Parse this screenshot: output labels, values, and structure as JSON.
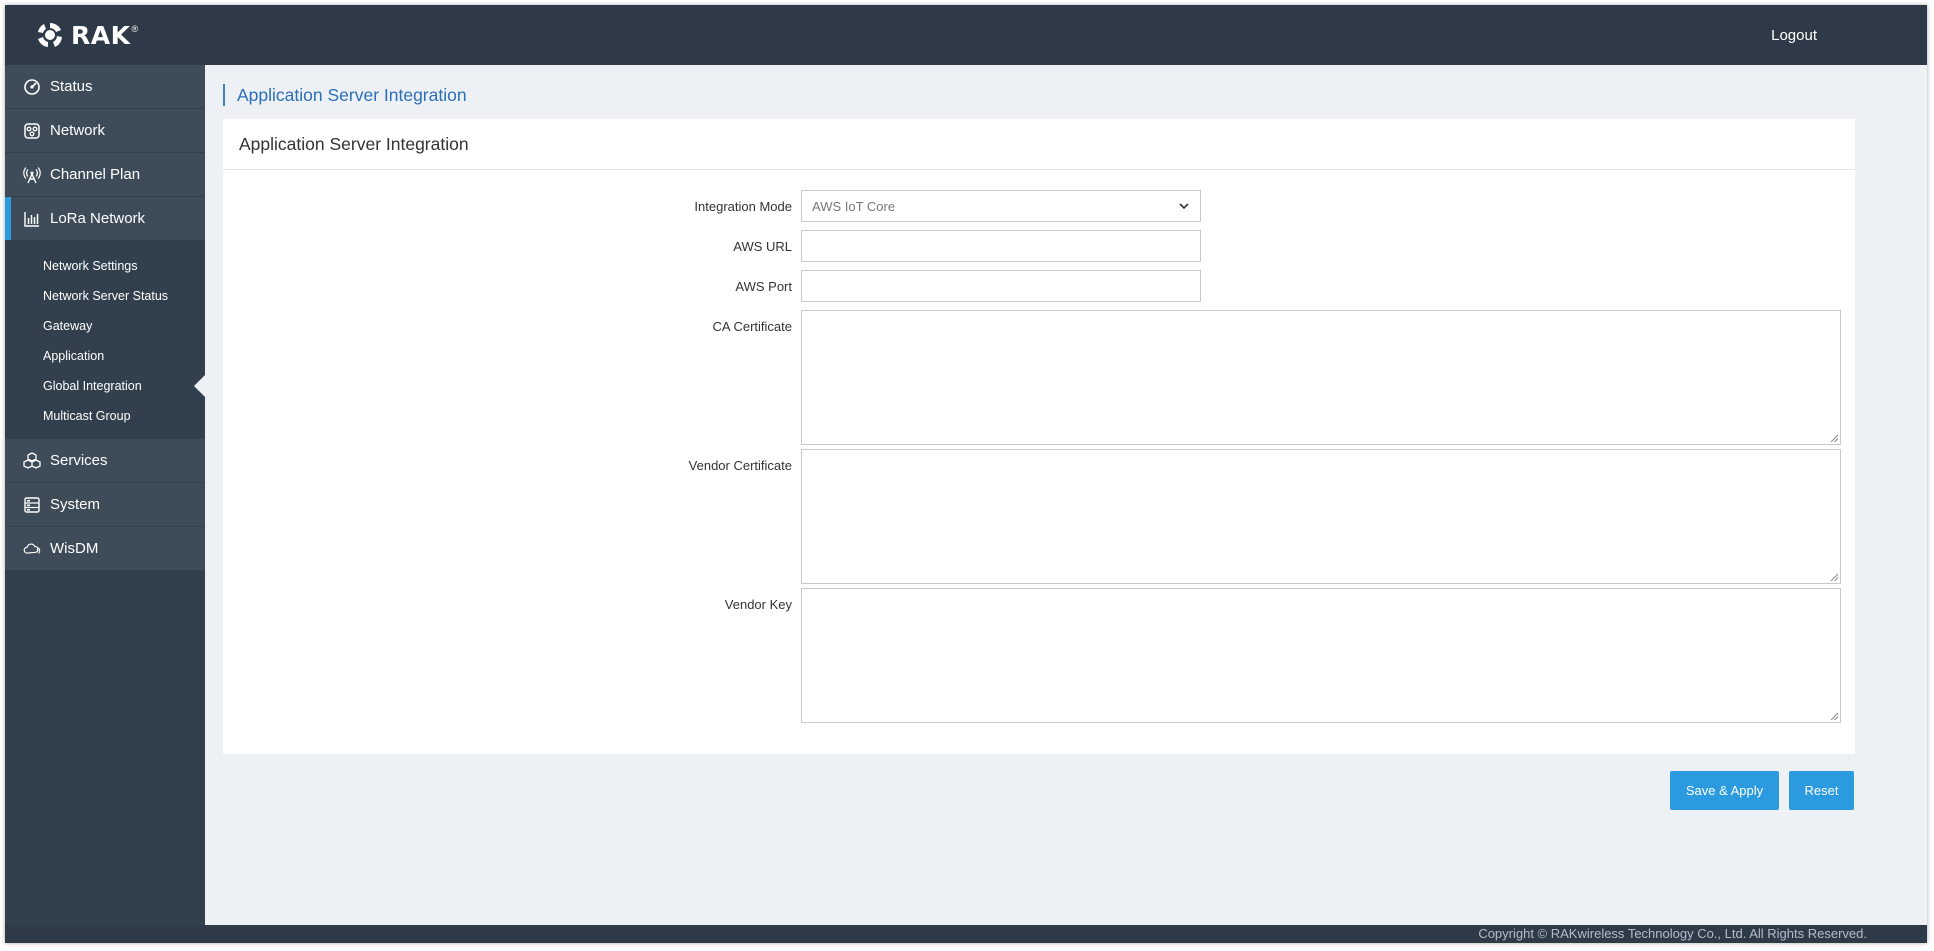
{
  "header": {
    "brand": "RAK",
    "logout": "Logout"
  },
  "sidebar": {
    "items": [
      {
        "label": "Status",
        "icon": "speedometer-icon"
      },
      {
        "label": "Network",
        "icon": "network-icon"
      },
      {
        "label": "Channel Plan",
        "icon": "antenna-icon"
      },
      {
        "label": "LoRa Network",
        "icon": "bar-chart-icon",
        "active": true
      }
    ],
    "sub_items": [
      "Network Settings",
      "Network Server Status",
      "Gateway",
      "Application",
      "Global Integration",
      "Multicast Group"
    ],
    "selected_sub_item": "Global Integration",
    "items_after": [
      {
        "label": "Services",
        "icon": "cubes-icon"
      },
      {
        "label": "System",
        "icon": "server-icon"
      },
      {
        "label": "WisDM",
        "icon": "cloud-icon"
      }
    ]
  },
  "main": {
    "page_title": "Application Server Integration",
    "panel_title": "Application Server Integration",
    "form": {
      "integration_mode_label": "Integration Mode",
      "integration_mode_value": "AWS IoT Core",
      "aws_url_label": "AWS URL",
      "aws_url_value": "",
      "aws_port_label": "AWS Port",
      "aws_port_value": "",
      "ca_certificate_label": "CA Certificate",
      "vendor_certificate_label": "Vendor Certificate",
      "vendor_key_label": "Vendor Key"
    },
    "buttons": {
      "save_apply": "Save & Apply",
      "reset": "Reset"
    }
  },
  "footer": {
    "copyright": "Copyright © RAKwireless Technology Co., Ltd. All Rights Reserved."
  },
  "colors": {
    "header_bg": "#2e3a47",
    "sidebar_bg": "#323f4c",
    "accent": "#2b9adf",
    "title_blue": "#2c6fb8",
    "page_bg": "#edf1f5"
  }
}
